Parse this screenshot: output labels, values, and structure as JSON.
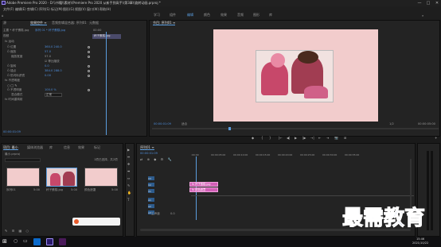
{
  "window": {
    "title": "Adobe Premiere Pro 2020 - D:\\\\书籍\\\\素材\\\\Premiere Pro 2020 从新手到高手\\\\第3章\\\\旋转动画.prproj *",
    "minimize": "—",
    "maximize": "□",
    "close": "✕"
  },
  "menu": [
    "文件(F)",
    "编辑(E)",
    "剪辑(C)",
    "序列(S)",
    "标记(M)",
    "图形(G)",
    "视图(V)",
    "窗口(W)",
    "帮助(H)"
  ],
  "workspaces": [
    "学习",
    "组件",
    "编辑",
    "颜色",
    "效果",
    "音频",
    "图形",
    "库"
  ],
  "active_workspace": "编辑",
  "effect_controls": {
    "tabs": [
      "源",
      "效果控件 ≡",
      "音频剪辑混合器: 序列01",
      "元数据"
    ],
    "source": "主要 * 杯子蛋糕.jpg",
    "clip": "序列 01 * 杯子蛋糕.jpg",
    "time_start": "00:00",
    "timeline_clip": "杯子蛋糕.jpg",
    "section_video": "视频",
    "fx_motion": "fx 运动",
    "rows": [
      {
        "label": "Ö 位置",
        "value": "360.0    240.0"
      },
      {
        "label": "Ö 缩放",
        "value": "57.0"
      },
      {
        "label": "缩放宽度",
        "value": "57.0"
      },
      {
        "label": "",
        "value": "☑ 等比缩放"
      },
      {
        "label": "Ö 旋转",
        "value": "0.0"
      },
      {
        "label": "Ö 锚点",
        "value": "384.0    288.0"
      },
      {
        "label": "Ö 防闪烁滤镜",
        "value": "0.00"
      }
    ],
    "fx_opacity": "fx 不透明度",
    "opacity_rows": [
      {
        "label": "Ö 不透明度",
        "value": "100.0 %"
      },
      {
        "label": "混合模式",
        "value": "正常"
      }
    ],
    "time_remap": "fx 时间重映射",
    "current_time": "00:00:01:09"
  },
  "program": {
    "title": "节目: 序列01 ≡",
    "timecode": "00:00:01:09",
    "fit": "适合",
    "ratio": "1/2",
    "duration": "00:00:05:00",
    "bg_color": "#f2cccc",
    "controls": [
      "◆",
      "{",
      "}",
      "|←",
      "◀|",
      "▶",
      "|▶",
      "→|",
      "⇤",
      "⇥",
      "📷",
      "⊞",
      "+"
    ]
  },
  "project": {
    "tabs": [
      "项目: 最小",
      "媒体浏览器",
      "库",
      "信息",
      "效果",
      "标记"
    ],
    "name": "最小.prproj",
    "count": "1项已选择，共2项",
    "items": [
      {
        "name": "序列01",
        "duration": "5:00"
      },
      {
        "name": "杯子蛋糕.jpg",
        "duration": "5:00"
      },
      {
        "name": "颜色遮罩",
        "duration": "5:00"
      }
    ]
  },
  "timeline": {
    "tab": "序列01 ≡",
    "timecode": "00:00:01:09",
    "ruler": [
      ":00:00",
      "00:00:05:00",
      "00:00:10:00",
      "00:00:15:00",
      "00:00:20:00",
      "00:00:25:00",
      "00:00:30:00",
      "00:00:35:00"
    ],
    "video_tracks": [
      "V3",
      "V2",
      "V1"
    ],
    "audio_tracks": [
      "A1",
      "A2",
      "A3"
    ],
    "master": "主声道",
    "master_val": "0.0",
    "clips": [
      {
        "label": "fx 杯子蛋糕.jpg",
        "track": "V2"
      },
      {
        "label": "fx 颜色遮罩",
        "track": "V1"
      }
    ],
    "clip_color": "#d35fb7"
  },
  "tools": [
    "▶",
    "⇹",
    "✥",
    "⬌",
    "⇔",
    "✎",
    "✋",
    "T"
  ],
  "watermark": "最需教育",
  "taskbar": {
    "time": "15:46",
    "date": "2021/10/22"
  }
}
